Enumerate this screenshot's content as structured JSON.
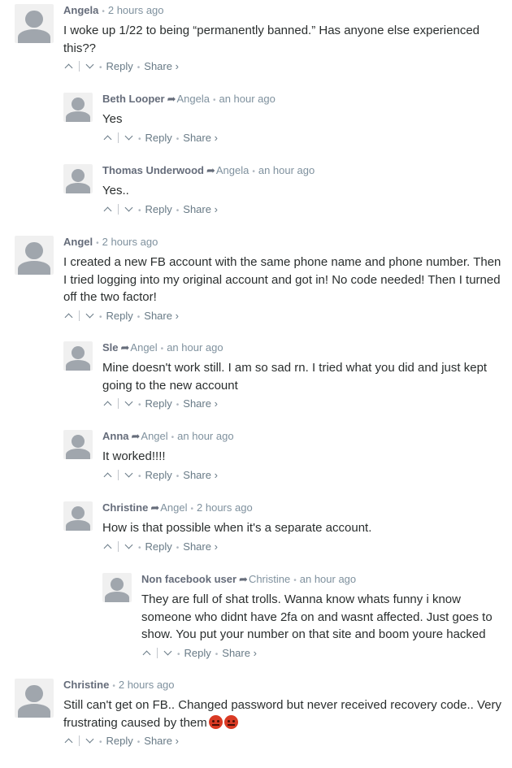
{
  "footer_labels": {
    "reply": "Reply",
    "share": "Share ›",
    "upvote_icon": "chevron-up-icon",
    "downvote_icon": "chevron-down-icon"
  },
  "comments": [
    {
      "author": "Angela",
      "parent": "",
      "time": "2 hours ago",
      "text": "I woke up 1/22 to being “permanently banned.” Has anyone else experienced this??",
      "emoji": ""
    },
    {
      "author": "Beth Looper",
      "parent": "Angela",
      "time": "an hour ago",
      "text": "Yes",
      "emoji": ""
    },
    {
      "author": "Thomas Underwood",
      "parent": "Angela",
      "time": "an hour ago",
      "text": "Yes..",
      "emoji": ""
    },
    {
      "author": "Angel",
      "parent": "",
      "time": "2 hours ago",
      "text": "I created a new FB account with the same phone name and phone number. Then I tried logging into my original account and got in! No code needed! Then I turned off the two factor!",
      "emoji": ""
    },
    {
      "author": "Sle",
      "parent": "Angel",
      "time": "an hour ago",
      "text": "Mine doesn't work still. I am so sad rn. I tried what you did and just kept going to the new account",
      "emoji": ""
    },
    {
      "author": "Anna",
      "parent": "Angel",
      "time": "an hour ago",
      "text": "It worked!!!!",
      "emoji": ""
    },
    {
      "author": "Christine",
      "parent": "Angel",
      "time": "2 hours ago",
      "text": "How is that possible when it's a separate account.",
      "emoji": ""
    },
    {
      "author": "Non facebook user",
      "parent": "Christine",
      "time": "an hour ago",
      "text": "They are full of shat trolls. Wanna know whats funny i know someone who didnt have 2fa on and wasnt affected. Just goes to show. You put your number on that site and boom youre hacked",
      "emoji": ""
    },
    {
      "author": "Christine",
      "parent": "",
      "time": "2 hours ago",
      "text": "Still can't get on FB.. Changed password but never received recovery code.. Very frustrating caused by them",
      "emoji": "angry-face-emoji ×2"
    }
  ]
}
